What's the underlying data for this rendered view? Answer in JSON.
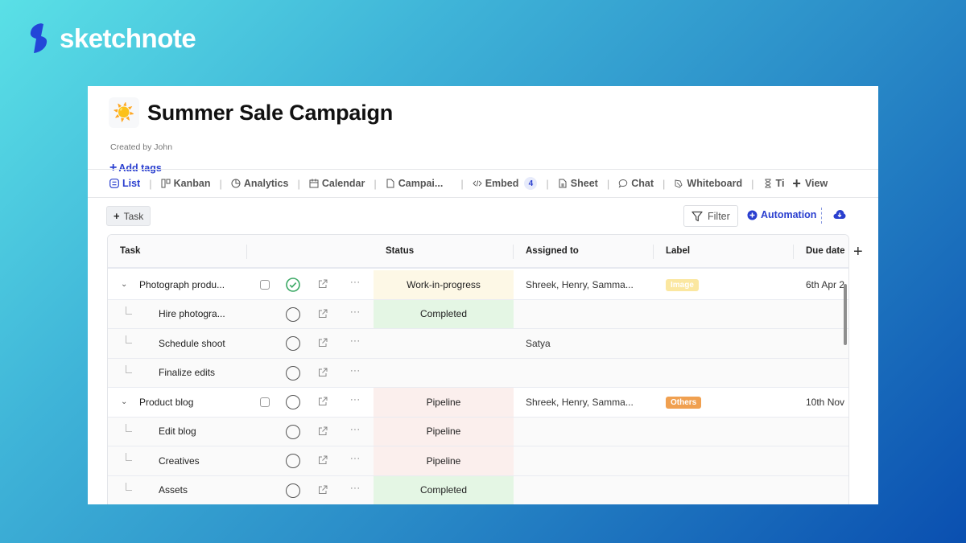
{
  "brand": {
    "name": "sketchnote",
    "logo_icon": "lightning-bolt-icon",
    "logo_color": "#2346d8"
  },
  "page": {
    "emoji": "☀️",
    "title": "Summer Sale Campaign",
    "created_by": "Created by John",
    "add_tags_label": "Add tags"
  },
  "tabs": [
    {
      "label": "List",
      "icon": "list-icon",
      "active": true
    },
    {
      "label": "Kanban",
      "icon": "kanban-icon"
    },
    {
      "label": "Analytics",
      "icon": "analytics-icon"
    },
    {
      "label": "Calendar",
      "icon": "calendar-icon"
    },
    {
      "label": "Campai...",
      "icon": "document-icon"
    },
    {
      "label": "Embed",
      "icon": "code-icon",
      "count": "4"
    },
    {
      "label": "Sheet",
      "icon": "sheet-icon"
    },
    {
      "label": "Chat",
      "icon": "chat-icon"
    },
    {
      "label": "Whiteboard",
      "icon": "whiteboard-icon"
    },
    {
      "label": "Ti",
      "icon": "hourglass-icon"
    }
  ],
  "add_view_label": "View",
  "toolbar": {
    "task_button": "Task",
    "filter_button": "Filter",
    "automation_button": "Automation"
  },
  "table": {
    "columns": [
      "Task",
      "Status",
      "Assigned to",
      "Label",
      "Due date"
    ],
    "rows": [
      {
        "type": "parent",
        "task": "Photograph produ...",
        "done": true,
        "status": "Work-in-progress",
        "status_kind": "wip",
        "assigned": "Shreek, Henry, Samma...",
        "label": "Image",
        "label_color": "#fbe7a0",
        "due": "6th Apr 2"
      },
      {
        "type": "sub",
        "task": "Hire photogra...",
        "done": false,
        "status": "Completed",
        "status_kind": "done",
        "assigned": "",
        "label": "",
        "due": ""
      },
      {
        "type": "sub",
        "task": "Schedule shoot",
        "done": false,
        "status": "",
        "status_kind": "",
        "assigned": "Satya",
        "label": "",
        "due": ""
      },
      {
        "type": "sub",
        "task": "Finalize edits",
        "done": false,
        "status": "",
        "status_kind": "",
        "assigned": "",
        "label": "",
        "due": ""
      },
      {
        "type": "parent",
        "task": "Product blog",
        "done": false,
        "status": "Pipeline",
        "status_kind": "pipe",
        "assigned": "Shreek, Henry, Samma...",
        "label": "Others",
        "label_color": "#f0a050",
        "due": "10th Nov"
      },
      {
        "type": "sub",
        "task": "Edit blog",
        "done": false,
        "status": "Pipeline",
        "status_kind": "pipe",
        "assigned": "",
        "label": "",
        "due": ""
      },
      {
        "type": "sub",
        "task": "Creatives",
        "done": false,
        "status": "Pipeline",
        "status_kind": "pipe",
        "assigned": "",
        "label": "",
        "due": ""
      },
      {
        "type": "sub",
        "task": "Assets",
        "done": false,
        "status": "Completed",
        "status_kind": "done",
        "assigned": "",
        "label": "",
        "due": ""
      }
    ]
  }
}
